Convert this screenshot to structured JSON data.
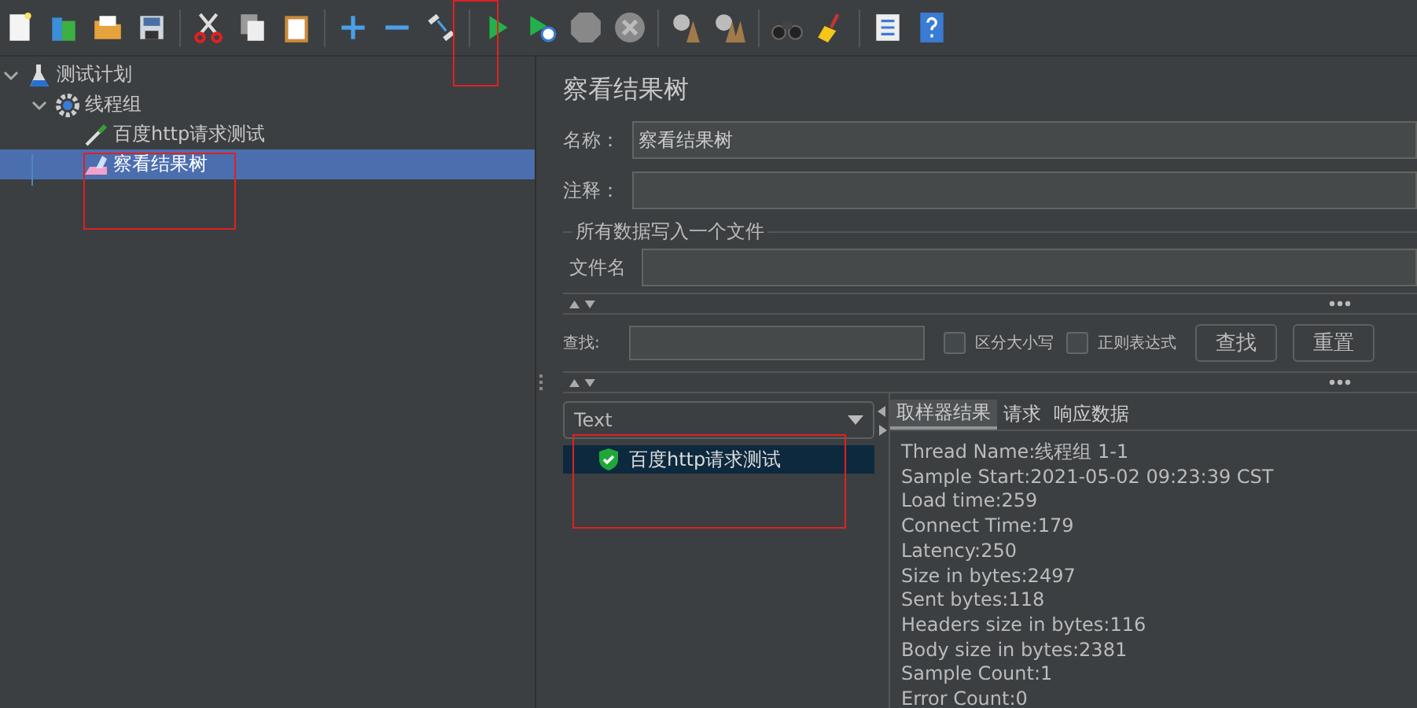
{
  "tree": [
    {
      "label": "测试计划",
      "kind": "plan",
      "expanded": true,
      "selected": false,
      "children": [
        {
          "label": "线程组",
          "kind": "threads",
          "expanded": true,
          "selected": false,
          "children": [
            {
              "label": "百度http请求测试",
              "kind": "sampler",
              "selected": false
            },
            {
              "label": "察看结果树",
              "kind": "listener",
              "selected": true
            }
          ]
        }
      ]
    }
  ],
  "panel": {
    "title": "察看结果树",
    "name_label": "名称：",
    "name_value": "察看结果树",
    "comment_label": "注释：",
    "file_group": "所有数据写入一个文件",
    "file_label": "文件名",
    "search_label": "查找:",
    "options": [
      {
        "label": "区分大小写",
        "checked": false
      },
      {
        "label": "正则表达式",
        "checked": false
      }
    ],
    "buttons": [
      "查找",
      "重置"
    ]
  },
  "results": {
    "renderer": "Text",
    "samples": [
      {
        "label": "百度http请求测试",
        "success": true,
        "selected": true
      }
    ],
    "tabs": [
      {
        "label": "取样器结果",
        "selected": true
      },
      {
        "label": "请求",
        "selected": false
      },
      {
        "label": "响应数据",
        "selected": false
      }
    ],
    "lines": [
      "Thread Name:线程组 1-1",
      "Sample Start:2021-05-02 09:23:39 CST",
      "Load time:259",
      "Connect Time:179",
      "Latency:250",
      "Size in bytes:2497",
      "Sent bytes:118",
      "Headers size in bytes:116",
      "Body size in bytes:2381",
      "Sample Count:1",
      "Error Count:0"
    ]
  }
}
